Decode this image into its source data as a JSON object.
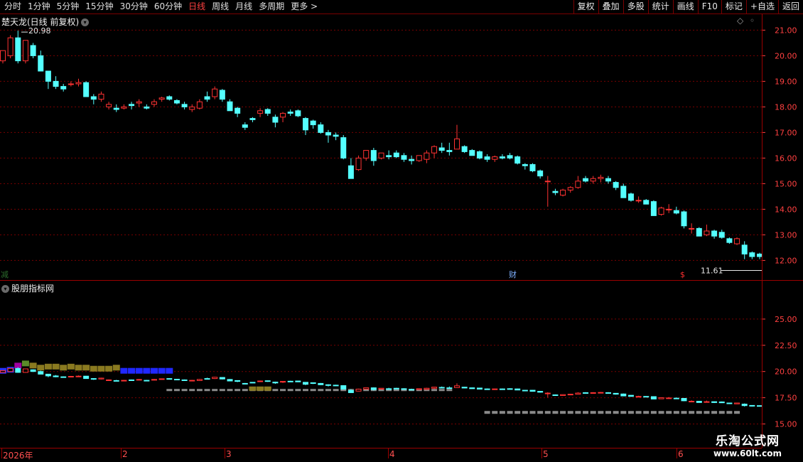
{
  "toolbar": {
    "periods": [
      "分时",
      "1分钟",
      "5分钟",
      "15分钟",
      "30分钟",
      "60分钟",
      "日线",
      "周线",
      "月线",
      "多周期",
      "更多 >"
    ],
    "active": "日线",
    "tools": [
      "复权",
      "叠加",
      "多股",
      "统计",
      "画线",
      "F10",
      "标记",
      "+自选",
      "返回"
    ]
  },
  "main": {
    "title": "楚天龙(日线 前复权)",
    "high_label": "20.98",
    "low_label": "11.61",
    "y_ticks": [
      "21.00",
      "20.00",
      "19.00",
      "18.00",
      "17.00",
      "16.00",
      "15.00",
      "14.00",
      "13.00",
      "12.00"
    ],
    "markers": {
      "left": "减",
      "mid": "财",
      "right": "$"
    }
  },
  "sub": {
    "title": "股朋指标网",
    "y_ticks": [
      "25.00",
      "22.50",
      "20.00",
      "17.50",
      "15.00"
    ]
  },
  "time_axis": {
    "labels": [
      "2026年",
      "2",
      "3",
      "4",
      "5",
      "6"
    ]
  },
  "watermark": {
    "title": "乐淘公式网",
    "url": "www.60lt.com"
  },
  "colors": {
    "up": "#ff3232",
    "down": "#54ffff",
    "grid": "#7a0000",
    "axis": "#ff4040"
  },
  "chart_data": {
    "type": "candlestick",
    "ylim": [
      11.4,
      21.4
    ],
    "high_mark": 20.98,
    "low_mark": 11.61,
    "ohlc": [
      [
        19.8,
        20.2,
        19.7,
        20.2
      ],
      [
        20.0,
        20.8,
        19.9,
        20.7
      ],
      [
        20.7,
        20.98,
        19.7,
        19.8
      ],
      [
        19.8,
        20.6,
        19.7,
        20.6
      ],
      [
        20.4,
        20.5,
        19.9,
        20.0
      ],
      [
        20.0,
        20.2,
        19.4,
        19.4
      ],
      [
        19.4,
        19.4,
        18.7,
        19.0
      ],
      [
        19.0,
        19.2,
        18.7,
        18.8
      ],
      [
        18.8,
        18.9,
        18.6,
        18.7
      ],
      [
        18.9,
        19.0,
        18.8,
        18.9
      ],
      [
        18.9,
        19.1,
        18.8,
        18.95
      ],
      [
        18.95,
        19.0,
        18.5,
        18.4
      ],
      [
        18.4,
        18.5,
        18.1,
        18.3
      ],
      [
        18.3,
        18.6,
        18.2,
        18.5
      ],
      [
        18.0,
        18.2,
        17.9,
        18.1
      ],
      [
        17.95,
        18.1,
        17.8,
        17.9
      ],
      [
        17.95,
        18.1,
        17.9,
        18.0
      ],
      [
        18.1,
        18.2,
        17.9,
        18.05
      ],
      [
        18.15,
        18.3,
        18.0,
        18.2
      ],
      [
        18.0,
        18.1,
        17.9,
        17.95
      ],
      [
        18.1,
        18.3,
        18.0,
        18.2
      ],
      [
        18.3,
        18.4,
        18.2,
        18.35
      ],
      [
        18.4,
        18.45,
        18.25,
        18.3
      ],
      [
        18.25,
        18.3,
        18.1,
        18.15
      ],
      [
        18.1,
        18.2,
        17.9,
        18.0
      ],
      [
        17.9,
        18.1,
        17.8,
        18.0
      ],
      [
        17.95,
        18.3,
        17.9,
        18.2
      ],
      [
        18.4,
        18.6,
        18.2,
        18.3
      ],
      [
        18.4,
        18.8,
        18.3,
        18.7
      ],
      [
        18.65,
        18.7,
        18.2,
        18.3
      ],
      [
        18.2,
        18.3,
        17.85,
        17.85
      ],
      [
        17.95,
        18.0,
        17.6,
        17.75
      ],
      [
        17.3,
        17.4,
        17.1,
        17.2
      ],
      [
        17.55,
        17.6,
        17.4,
        17.5
      ],
      [
        17.75,
        17.95,
        17.6,
        17.85
      ],
      [
        17.9,
        17.95,
        17.65,
        17.75
      ],
      [
        17.6,
        17.7,
        17.2,
        17.4
      ],
      [
        17.6,
        17.8,
        17.4,
        17.75
      ],
      [
        17.8,
        17.9,
        17.65,
        17.75
      ],
      [
        17.85,
        17.9,
        17.6,
        17.65
      ],
      [
        17.55,
        17.6,
        16.9,
        17.1
      ],
      [
        17.45,
        17.5,
        17.15,
        17.3
      ],
      [
        17.3,
        17.4,
        16.95,
        17.0
      ],
      [
        17.0,
        17.1,
        16.6,
        16.9
      ],
      [
        16.9,
        17.0,
        16.7,
        16.85
      ],
      [
        16.8,
        16.9,
        15.95,
        16.0
      ],
      [
        15.7,
        16.0,
        15.3,
        15.2
      ],
      [
        15.55,
        16.1,
        15.5,
        16.0
      ],
      [
        16.0,
        16.3,
        15.9,
        16.3
      ],
      [
        16.3,
        16.4,
        15.7,
        15.9
      ],
      [
        16.0,
        16.2,
        15.95,
        16.2
      ],
      [
        16.1,
        16.3,
        15.95,
        16.05
      ],
      [
        16.2,
        16.3,
        16.0,
        16.05
      ],
      [
        16.1,
        16.2,
        15.85,
        15.95
      ],
      [
        15.95,
        16.1,
        15.75,
        15.9
      ],
      [
        15.9,
        16.1,
        15.85,
        16.1
      ],
      [
        15.95,
        16.3,
        15.8,
        16.2
      ],
      [
        16.2,
        16.5,
        16.0,
        16.45
      ],
      [
        16.4,
        16.6,
        16.2,
        16.3
      ],
      [
        16.3,
        16.6,
        16.1,
        16.25
      ],
      [
        16.35,
        17.3,
        16.35,
        16.75
      ],
      [
        16.45,
        16.5,
        16.2,
        16.25
      ],
      [
        16.3,
        16.35,
        16.1,
        16.1
      ],
      [
        16.25,
        16.3,
        15.95,
        16.0
      ],
      [
        16.05,
        16.15,
        15.85,
        15.95
      ],
      [
        15.95,
        16.1,
        15.85,
        16.05
      ],
      [
        16.05,
        16.15,
        15.95,
        16.0
      ],
      [
        16.1,
        16.2,
        15.95,
        16.0
      ],
      [
        16.05,
        16.1,
        15.75,
        15.8
      ],
      [
        15.75,
        15.8,
        15.55,
        15.7
      ],
      [
        15.75,
        15.8,
        15.45,
        15.5
      ],
      [
        15.5,
        15.55,
        15.2,
        15.3
      ],
      [
        15.1,
        15.3,
        14.1,
        15.1
      ],
      [
        14.7,
        14.8,
        14.55,
        14.65
      ],
      [
        14.55,
        14.8,
        14.5,
        14.75
      ],
      [
        14.75,
        14.9,
        14.65,
        14.85
      ],
      [
        14.85,
        15.3,
        14.8,
        15.1
      ],
      [
        15.2,
        15.3,
        15.05,
        15.1
      ],
      [
        15.1,
        15.3,
        15.0,
        15.2
      ],
      [
        15.2,
        15.35,
        15.05,
        15.25
      ],
      [
        15.2,
        15.3,
        15.0,
        15.1
      ],
      [
        15.05,
        15.1,
        14.75,
        14.85
      ],
      [
        14.9,
        15.0,
        14.45,
        14.45
      ],
      [
        14.6,
        14.65,
        14.3,
        14.35
      ],
      [
        14.35,
        14.5,
        14.25,
        14.35
      ],
      [
        14.35,
        14.4,
        14.2,
        14.2
      ],
      [
        14.3,
        14.35,
        13.85,
        13.75
      ],
      [
        13.8,
        14.1,
        13.75,
        14.05
      ],
      [
        14.0,
        14.2,
        13.85,
        14.0
      ],
      [
        13.95,
        14.1,
        13.8,
        13.85
      ],
      [
        13.9,
        13.95,
        13.25,
        13.35
      ],
      [
        13.25,
        13.45,
        13.05,
        13.25
      ],
      [
        13.25,
        13.3,
        12.95,
        12.95
      ],
      [
        13.0,
        13.4,
        12.95,
        13.15
      ],
      [
        13.15,
        13.2,
        12.85,
        12.95
      ],
      [
        13.1,
        13.2,
        12.85,
        12.9
      ],
      [
        12.85,
        12.9,
        12.65,
        12.7
      ],
      [
        12.65,
        12.9,
        12.6,
        12.85
      ],
      [
        12.6,
        12.75,
        12.05,
        12.25
      ],
      [
        12.3,
        12.35,
        12.05,
        12.15
      ],
      [
        12.25,
        12.3,
        12.05,
        12.15
      ],
      [
        12.0,
        12.05,
        11.61,
        11.75
      ]
    ]
  }
}
